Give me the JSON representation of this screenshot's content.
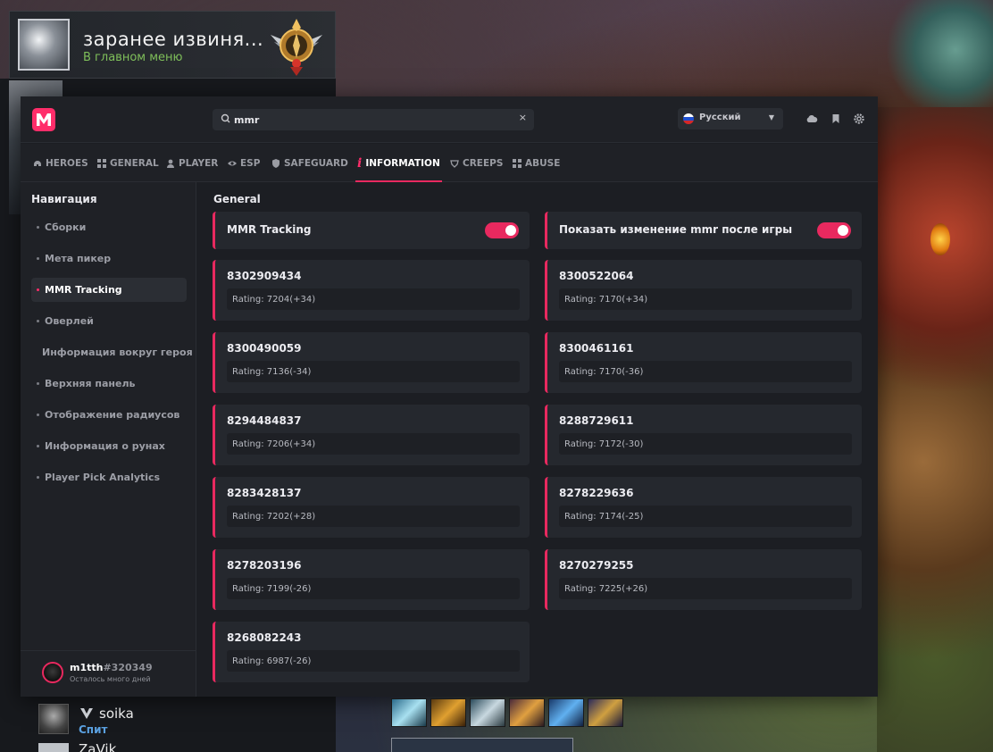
{
  "player_card": {
    "name": "заранее извиня...",
    "status": "В главном меню"
  },
  "window": {
    "search": {
      "value": "mmr",
      "clear": "×"
    },
    "language": {
      "label": "Русский"
    },
    "tabs": [
      {
        "label": "HEROES",
        "icon": "helmet-icon"
      },
      {
        "label": "GENERAL",
        "icon": "grid-icon"
      },
      {
        "label": "PLAYER",
        "icon": "person-icon"
      },
      {
        "label": "ESP",
        "icon": "eye-icon"
      },
      {
        "label": "SAFEGUARD",
        "icon": "shield-icon"
      },
      {
        "label": "INFORMATION",
        "icon": "info-icon",
        "active": true
      },
      {
        "label": "CREEPS",
        "icon": "creep-icon"
      },
      {
        "label": "ABUSE",
        "icon": "grid-icon"
      }
    ],
    "sidebar": {
      "title": "Навигация",
      "items": [
        {
          "label": "Сборки"
        },
        {
          "label": "Мета пикер"
        },
        {
          "label": "MMR Tracking",
          "active": true
        },
        {
          "label": "Оверлей"
        },
        {
          "label": "Информация вокруг героя"
        },
        {
          "label": "Верхняя панель"
        },
        {
          "label": "Отображение радиусов"
        },
        {
          "label": "Информация о рунах"
        },
        {
          "label": "Player Pick Analytics"
        }
      ],
      "user": {
        "name": "m1tth",
        "tag": "#320349",
        "sub": "Осталось много дней"
      }
    },
    "content": {
      "section_title": "General",
      "toggles": [
        {
          "label": "MMR Tracking",
          "on": true
        },
        {
          "label": "Показать изменение mmr после игры",
          "on": true
        }
      ],
      "matches": [
        {
          "id": "8302909434",
          "rating": "Rating: 7204(+34)"
        },
        {
          "id": "8300522064",
          "rating": "Rating: 7170(+34)"
        },
        {
          "id": "8300490059",
          "rating": "Rating: 7136(-34)"
        },
        {
          "id": "8300461161",
          "rating": "Rating: 7170(-36)"
        },
        {
          "id": "8294484837",
          "rating": "Rating: 7206(+34)"
        },
        {
          "id": "8288729611",
          "rating": "Rating: 7172(-30)"
        },
        {
          "id": "8283428137",
          "rating": "Rating: 7202(+28)"
        },
        {
          "id": "8278229636",
          "rating": "Rating: 7174(-25)"
        },
        {
          "id": "8278203196",
          "rating": "Rating: 7199(-26)"
        },
        {
          "id": "8270279255",
          "rating": "Rating: 7225(+26)"
        },
        {
          "id": "8268082243",
          "rating": "Rating: 6987(-26)"
        }
      ]
    }
  },
  "friends": [
    {
      "name": "soika",
      "status": "Спит"
    },
    {
      "name": "ZaVik"
    }
  ],
  "colors": {
    "accent": "#e8295f",
    "online_green": "#7fbf5a",
    "status_blue": "#5aa0e0"
  }
}
